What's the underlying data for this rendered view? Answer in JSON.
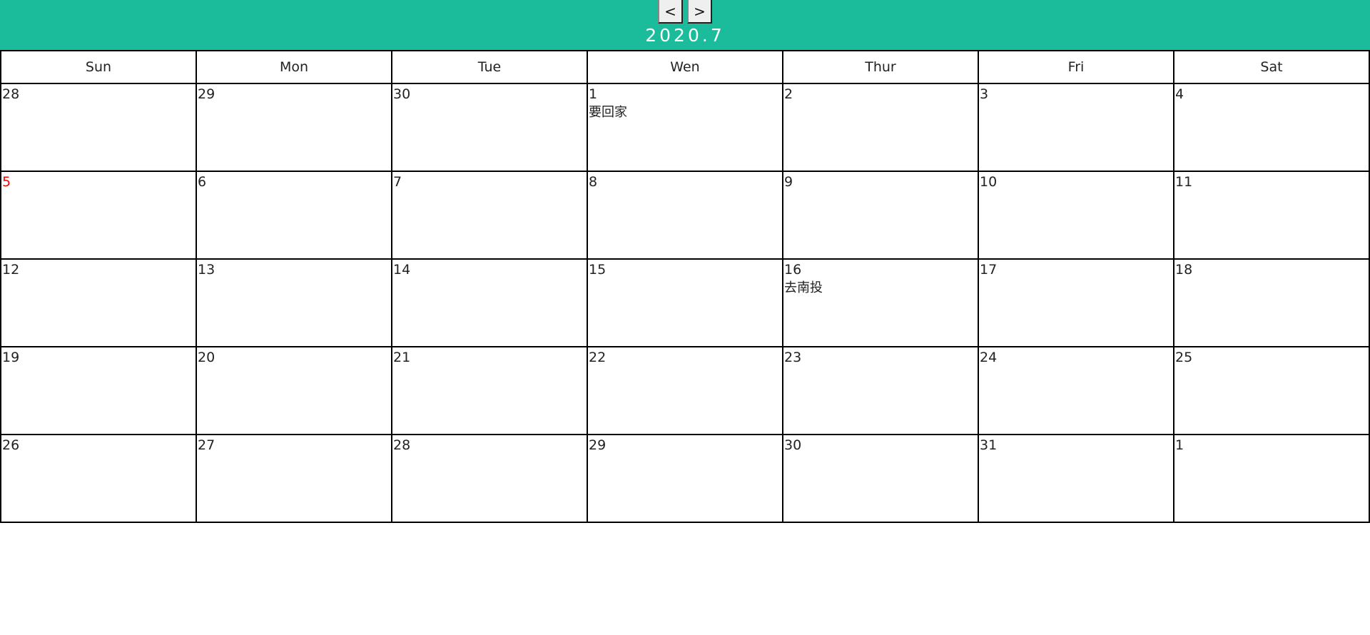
{
  "header": {
    "prev_label": "<",
    "next_label": ">",
    "title": "2020.7",
    "color": "#1abc9c"
  },
  "weekdays": [
    "Sun",
    "Mon",
    "Tue",
    "Wen",
    "Thur",
    "Fri",
    "Sat"
  ],
  "weeks": [
    [
      {
        "day": "28"
      },
      {
        "day": "29"
      },
      {
        "day": "30"
      },
      {
        "day": "1",
        "event": "要回家"
      },
      {
        "day": "2"
      },
      {
        "day": "3"
      },
      {
        "day": "4"
      }
    ],
    [
      {
        "day": "5",
        "highlight": true
      },
      {
        "day": "6"
      },
      {
        "day": "7"
      },
      {
        "day": "8"
      },
      {
        "day": "9"
      },
      {
        "day": "10"
      },
      {
        "day": "11"
      }
    ],
    [
      {
        "day": "12"
      },
      {
        "day": "13"
      },
      {
        "day": "14"
      },
      {
        "day": "15"
      },
      {
        "day": "16",
        "event": "去南投"
      },
      {
        "day": "17"
      },
      {
        "day": "18"
      }
    ],
    [
      {
        "day": "19"
      },
      {
        "day": "20"
      },
      {
        "day": "21"
      },
      {
        "day": "22"
      },
      {
        "day": "23"
      },
      {
        "day": "24"
      },
      {
        "day": "25"
      }
    ],
    [
      {
        "day": "26"
      },
      {
        "day": "27"
      },
      {
        "day": "28"
      },
      {
        "day": "29"
      },
      {
        "day": "30"
      },
      {
        "day": "31"
      },
      {
        "day": "1"
      }
    ]
  ]
}
